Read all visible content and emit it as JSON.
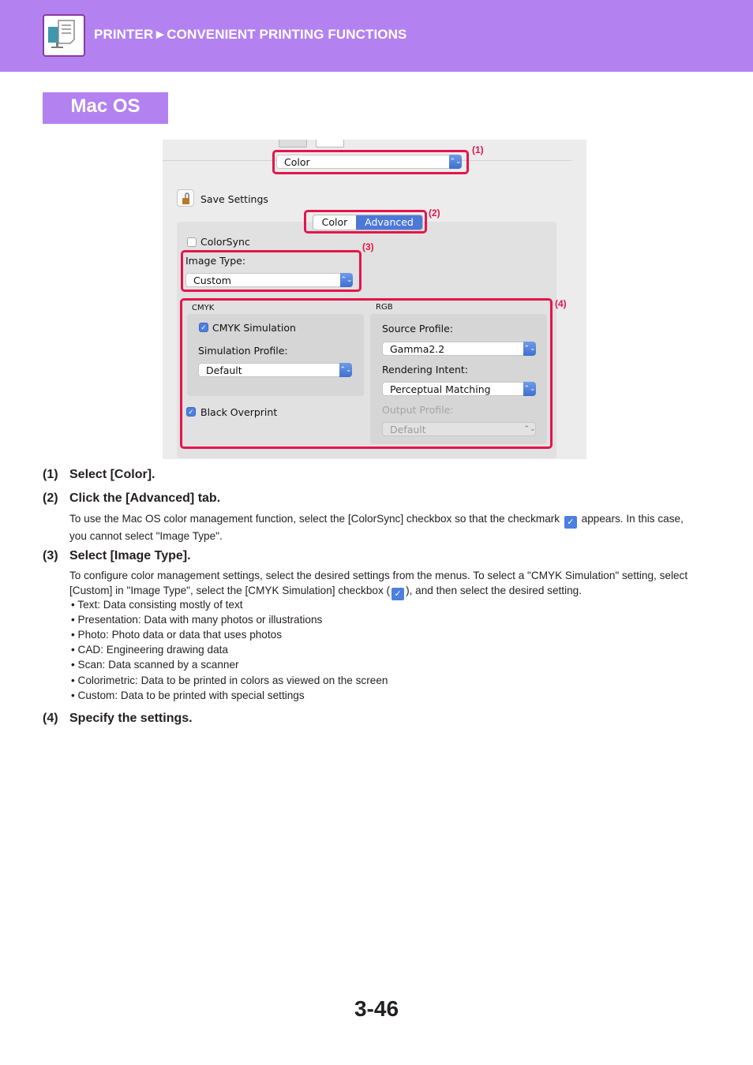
{
  "header": {
    "title": "PRINTER►CONVENIENT PRINTING FUNCTIONS",
    "icon": "printer-computer-icon",
    "background_color": "#b382f0"
  },
  "section_tag": "Mac OS",
  "dialog": {
    "print_options_popup": "Color",
    "save_settings_label": "Save Settings",
    "tabs": [
      "Color",
      "Advanced"
    ],
    "active_tab": "Advanced",
    "colorsync": {
      "label": "ColorSync",
      "checked": false
    },
    "image_type": {
      "label": "Image Type:",
      "value": "Custom"
    },
    "cmyk": {
      "heading": "CMYK",
      "simulation": {
        "label": "CMYK Simulation",
        "checked": true
      },
      "simulation_profile_label": "Simulation Profile:",
      "simulation_profile_value": "Default",
      "black_overprint": {
        "label": "Black Overprint",
        "checked": true
      }
    },
    "rgb": {
      "heading": "RGB",
      "source_profile_label": "Source Profile:",
      "source_profile_value": "Gamma2.2",
      "rendering_intent_label": "Rendering Intent:",
      "rendering_intent_value": "Perceptual Matching",
      "output_profile_label": "Output Profile:",
      "output_profile_value": "Default"
    },
    "callouts": [
      "(1)",
      "(2)",
      "(3)",
      "(4)"
    ],
    "highlight_color": "#e4154b"
  },
  "steps": [
    {
      "num": "(1)",
      "title": "Select [Color]."
    },
    {
      "num": "(2)",
      "title": "Click the [Advanced] tab.",
      "body_before": "To use the Mac OS color management function, select the [ColorSync] checkbox so that the checkmark",
      "body_after": "appears. In this case, you cannot select \"Image Type\"."
    },
    {
      "num": "(3)",
      "title": "Select [Image Type].",
      "body_before": "To configure color management settings, select the desired settings from the menus. To select a \"CMYK Simulation\" setting, select [Custom] in \"Image Type\", select the [CMYK Simulation] checkbox (",
      "body_after": "), and then select the desired setting.",
      "bullets": [
        "• Text:   Data consisting mostly of text",
        "• Presentation:   Data with many photos or illustrations",
        "• Photo:   Photo data or data that uses photos",
        "• CAD:  Engineering drawing data",
        "• Scan:  Data scanned by a scanner",
        "• Colorimetric:  Data to be printed in colors as viewed on the screen",
        "• Custom:  Data to be printed with special settings"
      ]
    },
    {
      "num": "(4)",
      "title": "Specify the settings."
    }
  ],
  "page_number": "3-46"
}
